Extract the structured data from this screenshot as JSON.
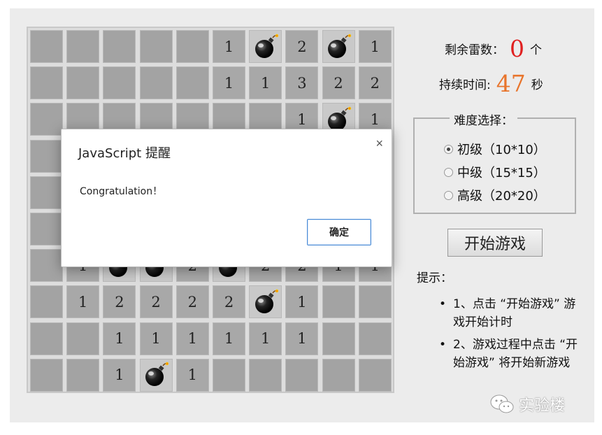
{
  "board": {
    "rows": [
      [
        "",
        "",
        "",
        "",
        "",
        "1",
        "M",
        "2",
        "M",
        "1"
      ],
      [
        "",
        "",
        "",
        "",
        "",
        "1",
        "1",
        "3",
        "2",
        "2"
      ],
      [
        "",
        "",
        "",
        "",
        "",
        "",
        "",
        "1",
        "M",
        "1"
      ],
      [
        "",
        "",
        "",
        "",
        "",
        "",
        "",
        "",
        "",
        ""
      ],
      [
        "",
        "",
        "",
        "",
        "",
        "",
        "",
        "",
        "",
        ""
      ],
      [
        "",
        "",
        "",
        "",
        "",
        "",
        "",
        "",
        "",
        ""
      ],
      [
        "",
        "1",
        "M",
        "M",
        "2",
        "M",
        "2",
        "2",
        "1",
        "1"
      ],
      [
        "",
        "1",
        "2",
        "2",
        "2",
        "2",
        "M",
        "1",
        "",
        ""
      ],
      [
        "",
        "",
        "1",
        "1",
        "1",
        "1",
        "1",
        "1",
        "",
        ""
      ],
      [
        "",
        "",
        "1",
        "M",
        "1",
        "",
        "",
        "",
        "",
        ""
      ]
    ],
    "mine_icon": "bomb-icon"
  },
  "status": {
    "remaining_label": "剩余雷数：",
    "remaining_value": "0",
    "remaining_unit": "个",
    "time_label": "持续时间:",
    "time_value": "47",
    "time_unit": "秒"
  },
  "difficulty": {
    "legend": "难度选择：",
    "options": [
      {
        "label": "初级（10*10）",
        "checked": true
      },
      {
        "label": "中级（15*15）",
        "checked": false
      },
      {
        "label": "高级（20*20）",
        "checked": false
      }
    ]
  },
  "start_button": "开始游戏",
  "tips": {
    "title": "提示：",
    "items": [
      "1、点击 “开始游戏” 游戏开始计时",
      "2、游戏过程中点击 “开始游戏” 将开始新游戏"
    ]
  },
  "dialog": {
    "title": "JavaScript 提醒",
    "message": "Congratulation！",
    "ok_label": "确定",
    "close_glyph": "×"
  },
  "watermark": {
    "text": "实验楼",
    "icon": "wechat-icon"
  },
  "colors": {
    "remaining_value": "#e02020",
    "time_value": "#e8742b",
    "cell": "#a3a3a3",
    "background": "#ececec",
    "dialog_button_border": "#4a8bd6"
  }
}
